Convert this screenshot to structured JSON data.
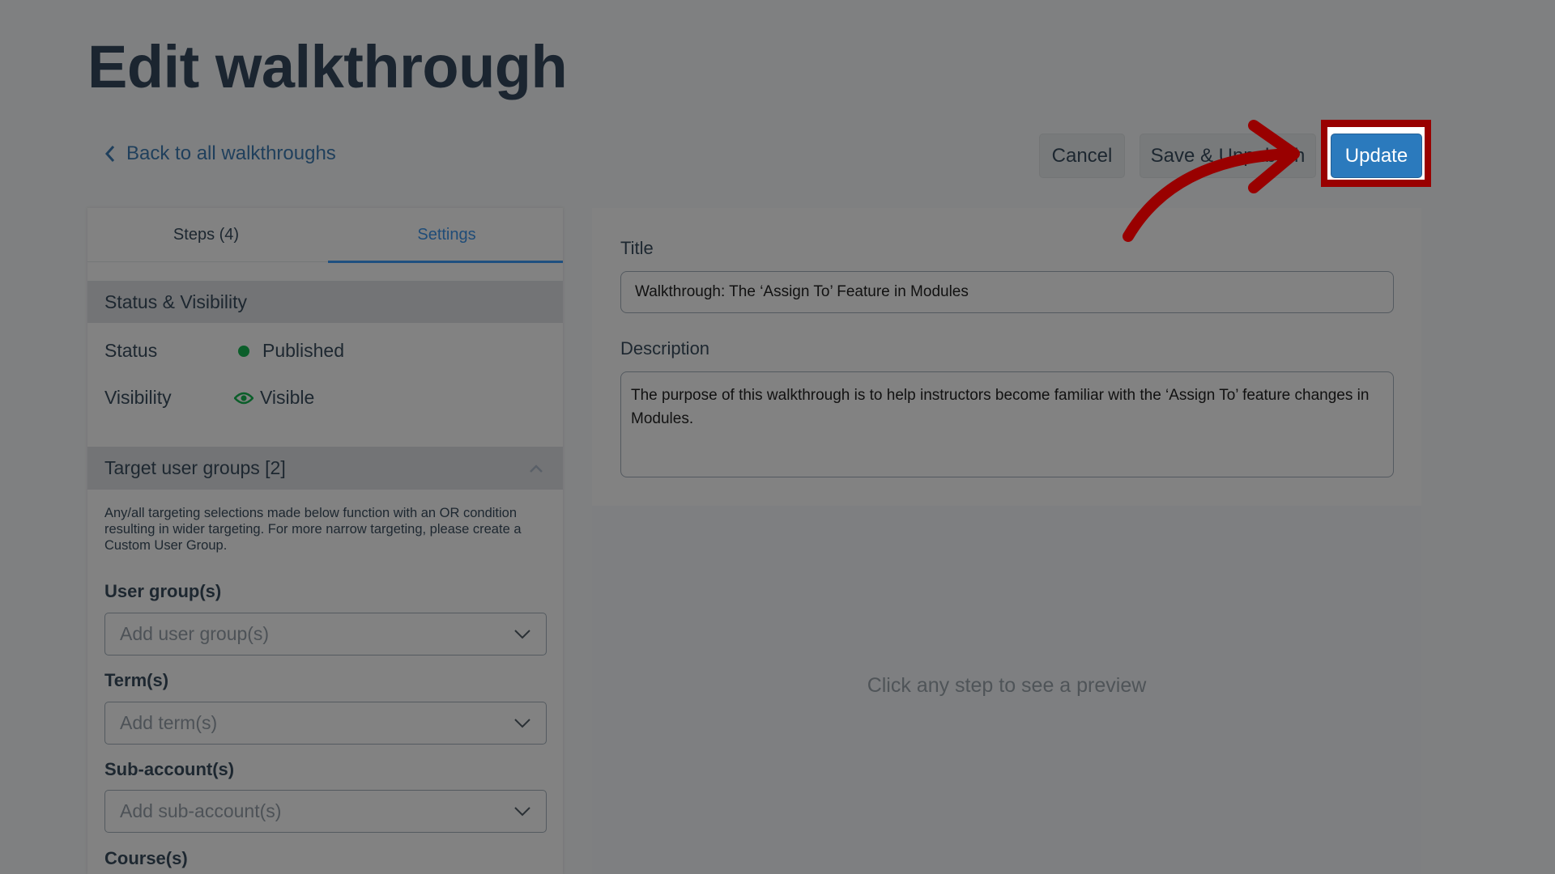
{
  "page": {
    "title": "Edit walkthrough"
  },
  "nav": {
    "back_label": "Back to all walkthroughs"
  },
  "toolbar": {
    "cancel_label": "Cancel",
    "save_unpublish_label": "Save & Unpublish",
    "update_label": "Update"
  },
  "tabs": [
    {
      "label": "Steps (4)",
      "active": false
    },
    {
      "label": "Settings",
      "active": true
    }
  ],
  "status_section": {
    "header": "Status & Visibility",
    "status_label": "Status",
    "status_value": "Published",
    "visibility_label": "Visibility",
    "visibility_value": "Visible"
  },
  "targeting": {
    "header": "Target user groups [2]",
    "note": "Any/all targeting selections made below function with an OR condition resulting in wider targeting. For more narrow targeting, please create a Custom User Group.",
    "fields": [
      {
        "label": "User group(s)",
        "placeholder": "Add user group(s)"
      },
      {
        "label": "Term(s)",
        "placeholder": "Add term(s)"
      },
      {
        "label": "Sub-account(s)",
        "placeholder": "Add sub-account(s)"
      }
    ],
    "courses_label": "Course(s)"
  },
  "details": {
    "title_label": "Title",
    "title_value": "Walkthrough: The ‘Assign To’ Feature in Modules",
    "description_label": "Description",
    "description_value": "The purpose of this walkthrough is to help instructors become familiar with the ‘Assign To’ feature changes in Modules."
  },
  "preview": {
    "empty_text": "Click any step to see a preview"
  },
  "colors": {
    "accent": "#2b7abd",
    "annotation": "#990000",
    "status_green": "#0b5e2a"
  },
  "icons": {
    "back": "chevron-left-icon",
    "status": "dot-icon",
    "visibility": "eye-icon",
    "collapse": "chevron-up-icon",
    "dropdown": "chevron-down-icon",
    "annotation": "curved-arrow-icon"
  }
}
